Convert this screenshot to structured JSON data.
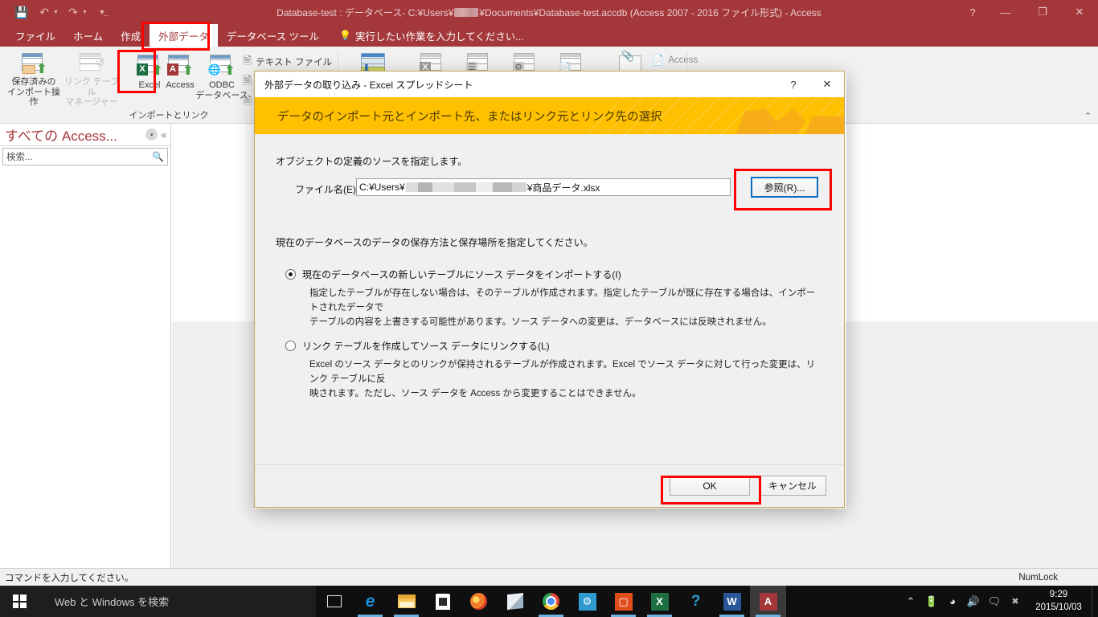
{
  "window": {
    "title_prefix": "Database-test : データベース- C:¥Users¥",
    "title_suffix": "¥Documents¥Database-test.accdb (Access 2007 - 2016 ファイル形式) - Access",
    "quick_access": [
      {
        "name": "save-icon",
        "glyph": "💾"
      },
      {
        "name": "undo-icon",
        "glyph": "↶"
      },
      {
        "name": "redo-icon",
        "glyph": "↷"
      },
      {
        "name": "customize-quick-access-icon",
        "glyph": "☰"
      }
    ],
    "controls": [
      {
        "name": "help-button",
        "glyph": "?"
      },
      {
        "name": "minimize-button",
        "glyph": "—"
      },
      {
        "name": "restore-button",
        "glyph": "❐"
      },
      {
        "name": "close-button",
        "glyph": "✕"
      }
    ]
  },
  "ribbon": {
    "tabs": [
      {
        "label": "ファイル",
        "active": false
      },
      {
        "label": "ホーム",
        "active": false
      },
      {
        "label": "作成",
        "active": false
      },
      {
        "label": "外部データ",
        "active": true
      },
      {
        "label": "データベース ツール",
        "active": false
      }
    ],
    "tell_me": "実行したい作業を入力してください...",
    "collapse_glyph": "⌃",
    "group_import": {
      "label": "インポートとリンク",
      "buttons": [
        {
          "name": "saved-imports-button",
          "line1": "保存済みの",
          "line2": "インポート操作",
          "icon": "saved-imports-icon"
        },
        {
          "name": "linked-table-manager-button",
          "line1": "リンク テーブル",
          "line2": "マネージャー",
          "icon": "linked-table-manager-icon"
        },
        {
          "name": "excel-import-button",
          "line1": "Excel",
          "line2": "",
          "icon": "excel-import-icon"
        },
        {
          "name": "access-import-button",
          "line1": "Access",
          "line2": "",
          "icon": "access-import-icon"
        },
        {
          "name": "odbc-database-button",
          "line1": "ODBC",
          "line2": "データベース",
          "icon": "odbc-database-icon"
        }
      ],
      "small_buttons": [
        {
          "name": "text-file-import-button",
          "label": "テキスト ファイル",
          "icon": "text-file-icon"
        },
        {
          "name": "xml-file-import-button",
          "label": "",
          "icon": "xml-file-icon"
        },
        {
          "name": "more-import-button",
          "label": "",
          "icon": "more-import-icon"
        }
      ]
    },
    "group_export": {
      "buttons": [
        {
          "name": "saved-exports-button",
          "icon": "saved-exports-icon"
        },
        {
          "name": "export-excel-button",
          "icon": "export-excel-icon"
        },
        {
          "name": "export-text-button",
          "icon": "export-text-icon"
        },
        {
          "name": "export-xml-button",
          "icon": "export-xml-icon"
        },
        {
          "name": "export-pdf-button",
          "icon": "export-pdf-icon"
        },
        {
          "name": "email-button",
          "icon": "email-icon"
        }
      ],
      "small_buttons": [
        {
          "name": "export-access-button",
          "label": "Access",
          "icon": "access-export-icon"
        }
      ]
    }
  },
  "nav_pane": {
    "title": "すべての Access...",
    "dropdown_glyph": "▾",
    "collapse_glyph": "«",
    "search_placeholder": "検索...",
    "search_value": "",
    "search_icon": "search-icon"
  },
  "dialog": {
    "title": "外部データの取り込み - Excel スプレッドシート",
    "help_glyph": "?",
    "close_glyph": "✕",
    "banner": "データのインポート元とインポート先、またはリンク元とリンク先の選択",
    "source_prompt": "オブジェクトの定義のソースを指定します。",
    "file_label": "ファイル名(E):",
    "file_value_prefix": "C:¥Users¥",
    "file_value_suffix": "¥商品データ.xlsx",
    "browse_button": "参照(R)...",
    "destination_prompt": "現在のデータベースのデータの保存方法と保存場所を指定してください。",
    "options": [
      {
        "name": "import-to-new-table-radio",
        "selected": true,
        "label": "現在のデータベースの新しいテーブルにソース データをインポートする(I)",
        "desc_line1": "指定したテーブルが存在しない場合は、そのテーブルが作成されます。指定したテーブルが既に存在する場合は、インポートされたデータで",
        "desc_line2": "テーブルの内容を上書きする可能性があります。ソース データへの変更は、データベースには反映されません。"
      },
      {
        "name": "create-linked-table-radio",
        "selected": false,
        "label": "リンク テーブルを作成してソース データにリンクする(L)",
        "desc_line1": "Excel のソース データとのリンクが保持されるテーブルが作成されます。Excel でソース データに対して行った変更は、リンク テーブルに反",
        "desc_line2": "映されます。ただし、ソース データを Access から変更することはできません。"
      }
    ],
    "ok_button": "OK",
    "cancel_button": "キャンセル"
  },
  "status_bar": {
    "message": "コマンドを入力してください。",
    "numlock": "NumLock"
  },
  "taskbar": {
    "start_icon": "windows-start-icon",
    "search_text": "Web と Windows を検索",
    "items": [
      {
        "name": "task-view-icon",
        "kind": "taskview"
      },
      {
        "name": "edge-icon",
        "kind": "edge",
        "glyph": "e"
      },
      {
        "name": "file-explorer-icon",
        "kind": "explorer"
      },
      {
        "name": "store-icon",
        "kind": "store"
      },
      {
        "name": "firefox-icon",
        "kind": "firefox"
      },
      {
        "name": "reader-icon",
        "kind": "reader"
      },
      {
        "name": "chrome-icon",
        "kind": "chrome"
      },
      {
        "name": "settings-icon",
        "kind": "settings"
      },
      {
        "name": "office-icon",
        "kind": "office",
        "glyph": "O"
      },
      {
        "name": "excel-icon",
        "kind": "excel",
        "glyph": "X"
      },
      {
        "name": "help-icon",
        "kind": "help",
        "glyph": "?"
      },
      {
        "name": "word-icon",
        "kind": "word",
        "glyph": "W"
      },
      {
        "name": "access-icon",
        "kind": "access",
        "glyph": "A"
      }
    ],
    "tray": [
      {
        "name": "show-hidden-icons-icon",
        "glyph": "⌃"
      },
      {
        "name": "battery-icon",
        "glyph": "🔋"
      },
      {
        "name": "wifi-icon",
        "glyph": "◠"
      },
      {
        "name": "volume-icon",
        "glyph": "🔊"
      },
      {
        "name": "action-center-icon",
        "glyph": "🗨"
      },
      {
        "name": "notification-badge-icon",
        "glyph": "✖"
      }
    ],
    "clock_time": "9:29",
    "clock_date": "2015/10/03"
  },
  "colors": {
    "accent_red": "#a4373a",
    "banner_yellow": "#ffc000",
    "highlight_red": "#ff0000",
    "focus_blue": "#0a6cc4"
  }
}
